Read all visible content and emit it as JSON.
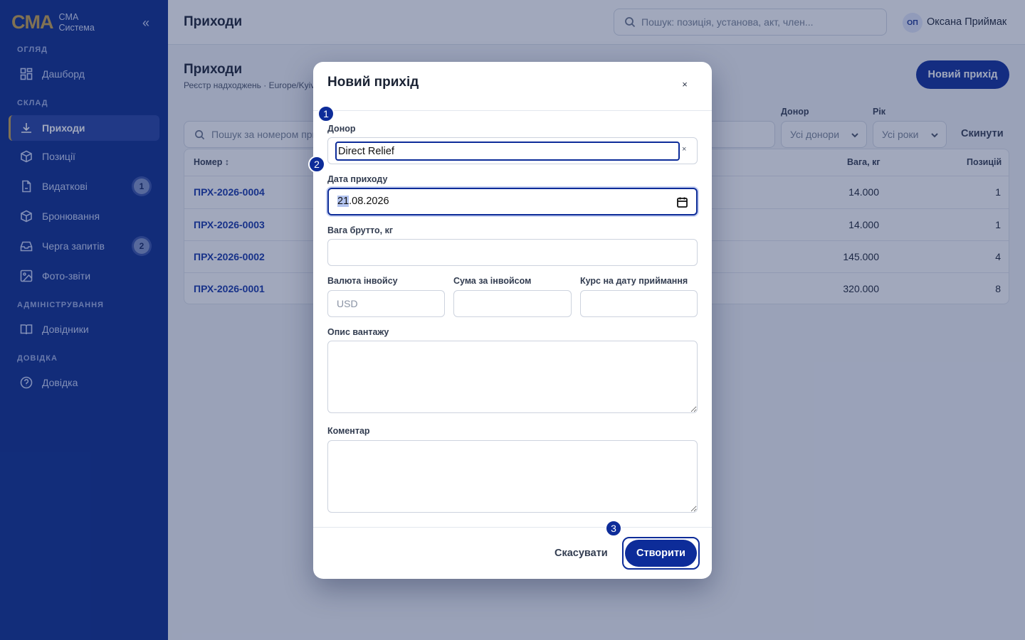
{
  "sidebar": {
    "brand_logo": "CMA",
    "brand_line1": "CMA",
    "brand_line2": "Система",
    "collapse": "«",
    "sections": {
      "overview": "ОГЛЯД",
      "warehouse": "СКЛАД",
      "admin": "АДМІНІСТРУВАННЯ",
      "help": "ДОВІДКА"
    },
    "items": [
      {
        "label": "Дашборд",
        "icon": "dashboard-icon"
      },
      {
        "label": "Приходи",
        "icon": "download-icon"
      },
      {
        "label": "Позиції",
        "icon": "box-icon"
      },
      {
        "label": "Видаткові",
        "icon": "document-icon",
        "badge": "1"
      },
      {
        "label": "Бронювання",
        "icon": "box-icon"
      },
      {
        "label": "Черга запитів",
        "icon": "inbox-icon",
        "badge": "2"
      },
      {
        "label": "Фото-звіти",
        "icon": "image-icon"
      },
      {
        "label": "Довідники",
        "icon": "book-icon"
      },
      {
        "label": "Довідка",
        "icon": "help-icon"
      }
    ]
  },
  "header": {
    "title": "Приходи",
    "search_placeholder": "Пошук: позиція, установа, акт, член...",
    "user_initials": "ОП",
    "user_name": "Оксана Приймак"
  },
  "page": {
    "title": "Приходи",
    "subtitle": "Реєстр надходжень · Europe/Kyiv",
    "new_button": "Новий прихід",
    "filters": {
      "search_placeholder": "Пошук за номером приходу",
      "donor_label": "Донор",
      "donor_value": "Усі донори",
      "year_label": "Рік",
      "year_value": "Усі роки",
      "reset": "Скинути"
    },
    "table": {
      "columns": {
        "number": "Номер ↕",
        "weight": "Вага, кг",
        "positions": "Позицій"
      },
      "rows": [
        {
          "number": "ПРХ-2026-0004",
          "weight": "14.000",
          "positions": "1"
        },
        {
          "number": "ПРХ-2026-0003",
          "weight": "14.000",
          "positions": "1"
        },
        {
          "number": "ПРХ-2026-0002",
          "weight": "145.000",
          "positions": "4"
        },
        {
          "number": "ПРХ-2026-0001",
          "weight": "320.000",
          "positions": "8"
        }
      ]
    }
  },
  "modal": {
    "title": "Новий прихід",
    "close": "×",
    "donor_label": "Донор",
    "donor_value": "Direct Relief",
    "donor_clear": "×",
    "date_label": "Дата приходу",
    "date_day": "21",
    "date_rest": ".08.2026",
    "weight_label": "Вага брутто, кг",
    "currency_label": "Валюта інвойсу",
    "currency_placeholder": "USD",
    "amount_label": "Сума за інвойсом",
    "rate_label": "Курс на дату приймання",
    "cargo_label": "Опис вантажу",
    "comment_label": "Коментар",
    "cancel": "Скасувати",
    "create": "Створити"
  },
  "markers": [
    "1",
    "2",
    "3"
  ],
  "colors": {
    "sidebar_bg": "#0a2a8c",
    "accent": "#0d2c99",
    "brand_gold": "#c8a24a",
    "link": "#1335a8"
  }
}
